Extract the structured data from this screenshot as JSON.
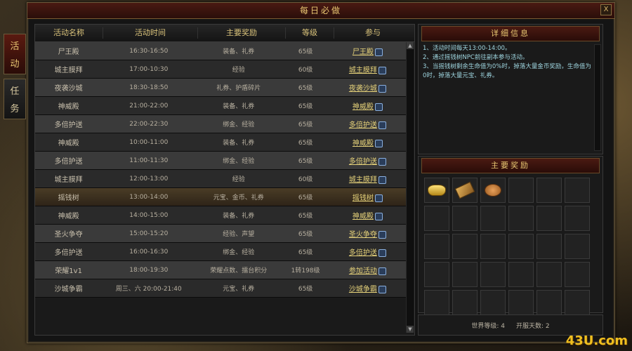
{
  "window": {
    "title": "每日必做",
    "close_label": "X"
  },
  "side_tabs": [
    {
      "chars": [
        "活",
        "动"
      ],
      "active": true
    },
    {
      "chars": [
        "任",
        "务"
      ],
      "active": false
    }
  ],
  "table": {
    "headers": [
      "活动名称",
      "活动时间",
      "主要奖励",
      "等级",
      "参与"
    ],
    "rows": [
      {
        "name": "尸王殿",
        "time": "16:30-16:50",
        "reward": "装备、礼券",
        "level": "65级",
        "action": "尸王殿"
      },
      {
        "name": "城主膜拜",
        "time": "17:00-10:30",
        "reward": "经验",
        "level": "60级",
        "action": "城主膜拜"
      },
      {
        "name": "夜袭沙城",
        "time": "18:30-18:50",
        "reward": "礼券、护盾碎片",
        "level": "65级",
        "action": "夜袭沙城"
      },
      {
        "name": "神威殿",
        "time": "21:00-22:00",
        "reward": "装备、礼券",
        "level": "65级",
        "action": "神威殿"
      },
      {
        "name": "多倍护送",
        "time": "22:00-22:30",
        "reward": "绑金、经验",
        "level": "65级",
        "action": "多倍护送"
      },
      {
        "name": "神威殿",
        "time": "10:00-11:00",
        "reward": "装备、礼券",
        "level": "65级",
        "action": "神威殿"
      },
      {
        "name": "多倍护送",
        "time": "11:00-11:30",
        "reward": "绑金、经验",
        "level": "65级",
        "action": "多倍护送"
      },
      {
        "name": "城主膜拜",
        "time": "12:00-13:00",
        "reward": "经验",
        "level": "60级",
        "action": "城主膜拜"
      },
      {
        "name": "摇钱树",
        "time": "13:00-14:00",
        "reward": "元宝、金币、礼券",
        "level": "65级",
        "action": "摇钱树"
      },
      {
        "name": "神威殿",
        "time": "14:00-15:00",
        "reward": "装备、礼券",
        "level": "65级",
        "action": "神威殿"
      },
      {
        "name": "圣火争夺",
        "time": "15:00-15:20",
        "reward": "经验、声望",
        "level": "65级",
        "action": "圣火争夺"
      },
      {
        "name": "多倍护送",
        "time": "16:00-16:30",
        "reward": "绑金、经验",
        "level": "65级",
        "action": "多倍护送"
      },
      {
        "name": "荣耀1v1",
        "time": "18:00-19:30",
        "reward": "荣耀点数、擂台积分",
        "level": "1转198级",
        "action": "参加活动"
      },
      {
        "name": "沙城争霸",
        "time": "周三、六 20:00-21:40",
        "reward": "元宝、礼券",
        "level": "65级",
        "action": "沙城争霸"
      }
    ]
  },
  "detail": {
    "title": "详细信息",
    "lines": [
      "1、活动时间每天13:00-14:00。",
      "2、通过摇钱树NPC前往副本参与活动。",
      "3、当摇钱树剩余生命值为0%时，掉落大量金币奖励，生命值为0时，掉落大量元宝、礼券。"
    ]
  },
  "rewards": {
    "title": "主要奖励",
    "items": [
      "gold-ingot-icon",
      "ticket-icon",
      "coin-stack-icon"
    ],
    "slot_count": 30
  },
  "footer": {
    "world_level": "世界等级: 4",
    "server_days": "开服天数: 2"
  },
  "watermark": "43U.com"
}
